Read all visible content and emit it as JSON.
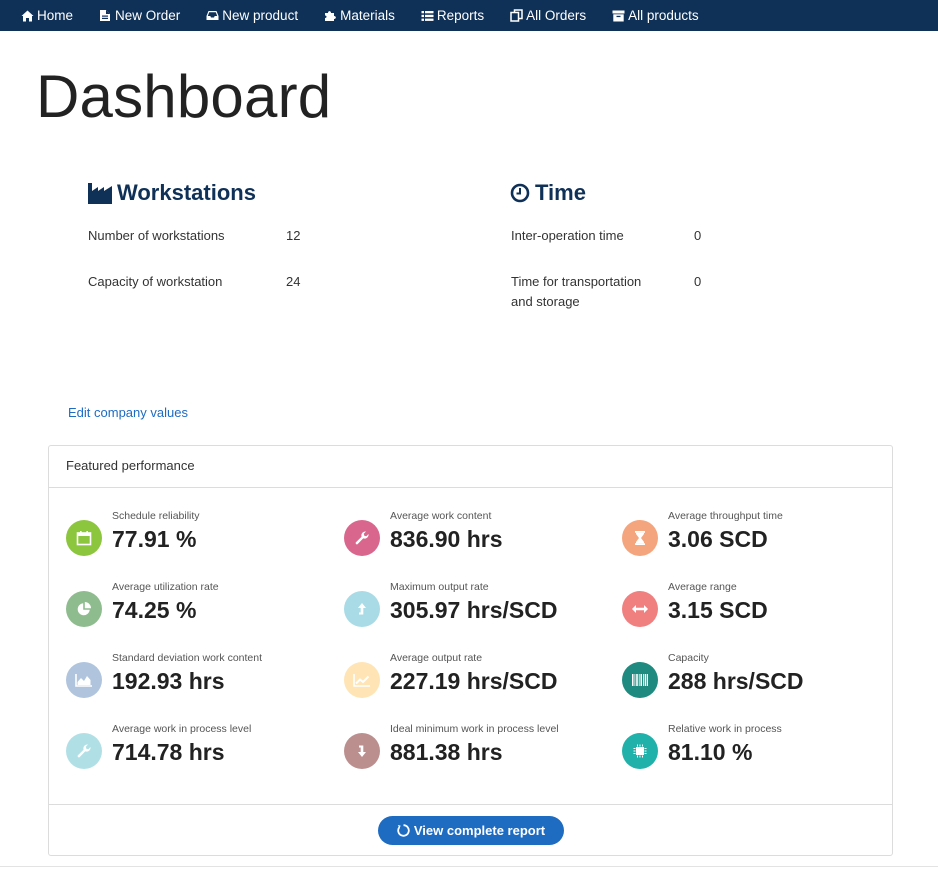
{
  "nav": [
    {
      "label": "Home",
      "icon": "home-icon"
    },
    {
      "label": "New Order",
      "icon": "document-icon"
    },
    {
      "label": "New product",
      "icon": "inbox-icon"
    },
    {
      "label": "Materials",
      "icon": "puzzle-icon"
    },
    {
      "label": "Reports",
      "icon": "list-icon"
    },
    {
      "label": "All Orders",
      "icon": "copy-icon"
    },
    {
      "label": "All products",
      "icon": "archive-icon"
    }
  ],
  "page_title": "Dashboard",
  "workstations": {
    "title": "Workstations",
    "icon": "factory-icon",
    "rows": [
      {
        "label": "Number of workstations",
        "value": "12"
      },
      {
        "label": "Capacity of workstation",
        "value": "24"
      }
    ]
  },
  "time": {
    "title": "Time",
    "icon": "clock-icon",
    "rows": [
      {
        "label_line1": "Inter-operation time",
        "label_line2": "",
        "value": "0"
      },
      {
        "label_line1": "Time for transportation",
        "label_line2": "and storage",
        "value": "0"
      }
    ]
  },
  "edit_link": "Edit company values",
  "panel": {
    "title": "Featured performance",
    "button": "View complete report",
    "metrics": [
      {
        "label": "Schedule reliability",
        "value": "77.91 %",
        "icon": "calendar-icon",
        "color": "#8cc63f"
      },
      {
        "label": "Average work content",
        "value": "836.90 hrs",
        "icon": "wrench-icon",
        "color": "#d9668d"
      },
      {
        "label": "Average throughput time",
        "value": "3.06 SCD",
        "icon": "hourglass-icon",
        "color": "#f5a57d"
      },
      {
        "label": "Average utilization rate",
        "value": "74.25 %",
        "icon": "pie-chart-icon",
        "color": "#8fbc8f"
      },
      {
        "label": "Maximum output rate",
        "value": "305.97 hrs/SCD",
        "icon": "arrow-up-icon",
        "color": "#a8dbe6"
      },
      {
        "label": "Average range",
        "value": "3.15 SCD",
        "icon": "arrows-h-icon",
        "color": "#f08080"
      },
      {
        "label": "Standard deviation work content",
        "value": "192.93 hrs",
        "icon": "area-chart-icon",
        "color": "#b0c4de"
      },
      {
        "label": "Average output rate",
        "value": "227.19 hrs/SCD",
        "icon": "line-chart-icon",
        "color": "#ffe4b5"
      },
      {
        "label": "Capacity",
        "value": "288 hrs/SCD",
        "icon": "barcode-icon",
        "color": "#1f8a7f"
      },
      {
        "label": "Average work in process level",
        "value": "714.78 hrs",
        "icon": "wrench-icon",
        "color": "#b0e0e6"
      },
      {
        "label": "Ideal minimum work in process level",
        "value": "881.38 hrs",
        "icon": "arrow-down-icon",
        "color": "#bc8f8f"
      },
      {
        "label": "Relative work in process",
        "value": "81.10 %",
        "icon": "chip-icon",
        "color": "#20b2aa"
      }
    ]
  }
}
